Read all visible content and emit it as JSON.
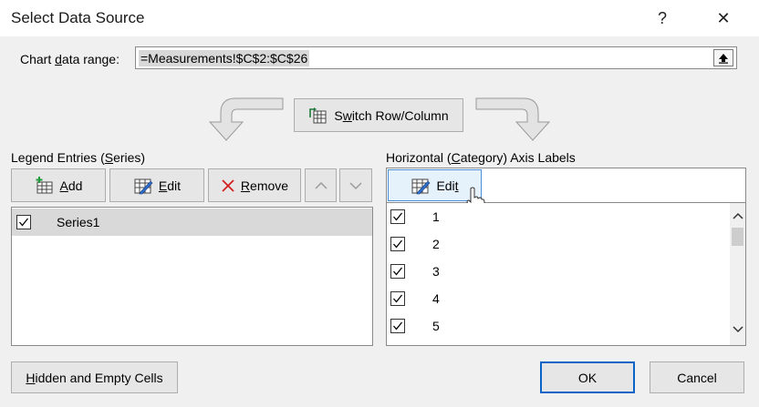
{
  "window": {
    "title": "Select Data Source",
    "help": "?",
    "close": "✕"
  },
  "range": {
    "label_pre": "Chart ",
    "label_u": "d",
    "label_post": "ata range:",
    "value": "=Measurements!$C$2:$C$26"
  },
  "switch": {
    "pre": "S",
    "u": "w",
    "post": "itch Row/Column"
  },
  "legend": {
    "heading_pre": "Legend Entries (",
    "heading_u": "S",
    "heading_post": "eries)",
    "add": {
      "u": "A",
      "post": "dd"
    },
    "edit": {
      "u": "E",
      "post": "dit"
    },
    "remove": {
      "u": "R",
      "post": "emove"
    },
    "series": [
      {
        "name": "Series1",
        "checked": true,
        "selected": true
      }
    ]
  },
  "axis": {
    "heading_pre": "Horizontal (",
    "heading_u": "C",
    "heading_post": "ategory) Axis Labels",
    "edit": {
      "pre": "Edi",
      "u": "t"
    },
    "items": [
      "1",
      "2",
      "3",
      "4",
      "5"
    ]
  },
  "footer": {
    "hidden": {
      "u": "H",
      "post": "idden and Empty Cells"
    },
    "ok": "OK",
    "cancel": "Cancel"
  }
}
